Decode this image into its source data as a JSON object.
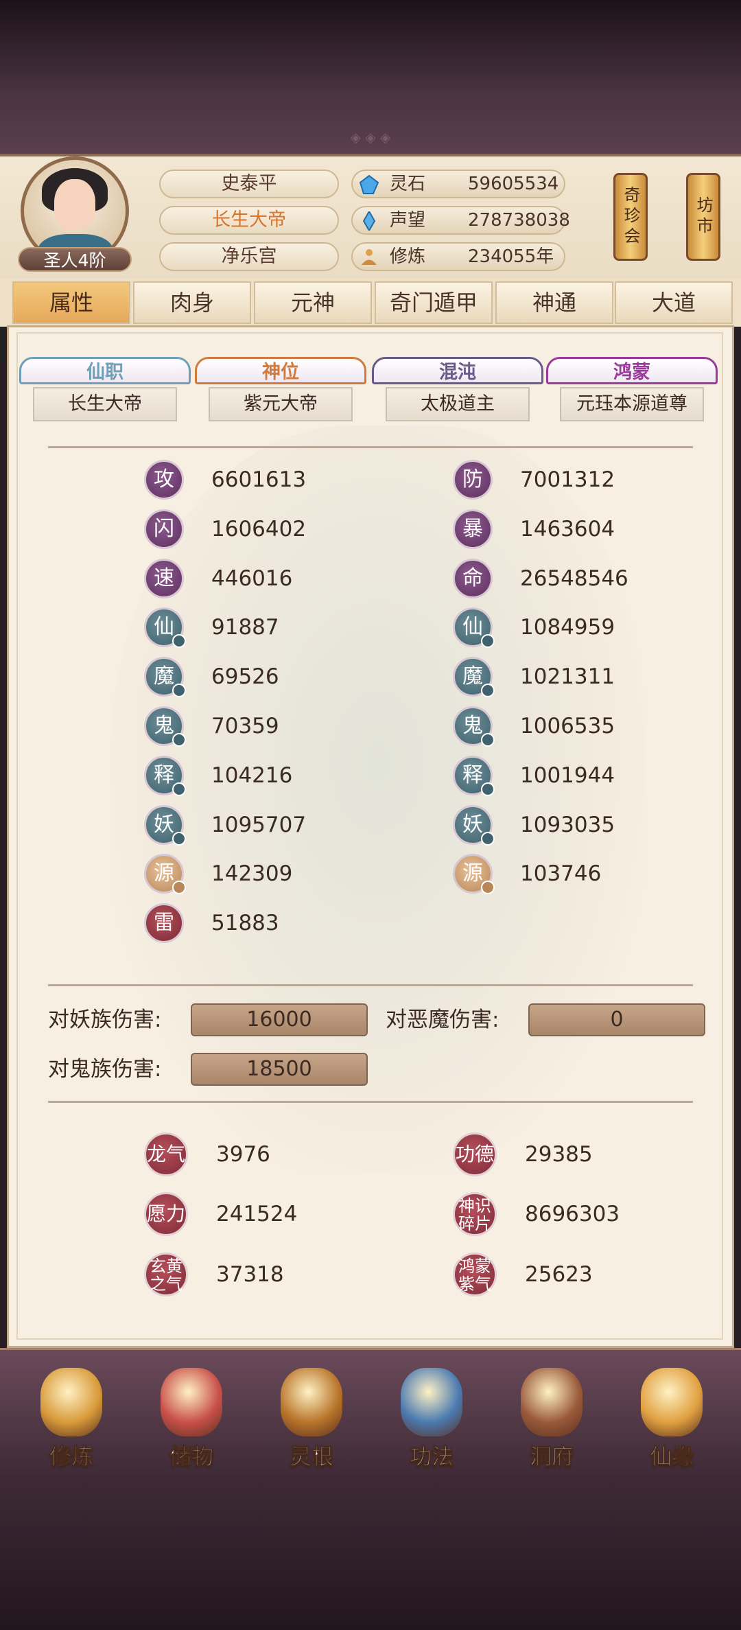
{
  "player": {
    "name": "史泰平",
    "title": "长生大帝",
    "palace": "净乐宫",
    "rank": "圣人4阶"
  },
  "resources": [
    {
      "label": "灵石",
      "value": "59605534",
      "icon": "spirit-stone-icon"
    },
    {
      "label": "声望",
      "value": "278738038",
      "icon": "prestige-crystal-icon"
    },
    {
      "label": "修炼",
      "value": "234055年",
      "icon": "meditation-icon"
    }
  ],
  "shops": {
    "treasure_fair": "奇珍会",
    "market": "坊市"
  },
  "tabs": [
    "属性",
    "肉身",
    "元神",
    "奇门遁甲",
    "神通",
    "大道"
  ],
  "active_tab": "属性",
  "titles": [
    {
      "label": "仙职",
      "value": "长生大帝",
      "color": "#6f9fb8"
    },
    {
      "label": "神位",
      "value": "紫元大帝",
      "color": "#d07a3e"
    },
    {
      "label": "混沌",
      "value": "太极道主",
      "color": "#6a5a8a"
    },
    {
      "label": "鸿蒙",
      "value": "元珏本源道尊",
      "color": "#9b3a9b"
    }
  ],
  "stats_left": [
    {
      "char": "攻",
      "value": "6601613",
      "style": "purple"
    },
    {
      "char": "闪",
      "value": "1606402",
      "style": "purple"
    },
    {
      "char": "速",
      "value": "446016",
      "style": "purple"
    },
    {
      "char": "仙",
      "value": "91887",
      "style": "teal"
    },
    {
      "char": "魔",
      "value": "69526",
      "style": "teal"
    },
    {
      "char": "鬼",
      "value": "70359",
      "style": "teal"
    },
    {
      "char": "释",
      "value": "104216",
      "style": "teal"
    },
    {
      "char": "妖",
      "value": "1095707",
      "style": "teal"
    },
    {
      "char": "源",
      "value": "142309",
      "style": "tan"
    },
    {
      "char": "雷",
      "value": "51883",
      "style": "red"
    }
  ],
  "stats_right": [
    {
      "char": "防",
      "value": "7001312",
      "style": "purple"
    },
    {
      "char": "暴",
      "value": "1463604",
      "style": "purple"
    },
    {
      "char": "命",
      "value": "26548546",
      "style": "purple"
    },
    {
      "char": "仙",
      "value": "1084959",
      "style": "teal"
    },
    {
      "char": "魔",
      "value": "1021311",
      "style": "teal"
    },
    {
      "char": "鬼",
      "value": "1006535",
      "style": "teal"
    },
    {
      "char": "释",
      "value": "1001944",
      "style": "teal"
    },
    {
      "char": "妖",
      "value": "1093035",
      "style": "teal"
    },
    {
      "char": "源",
      "value": "103746",
      "style": "tan"
    }
  ],
  "damage": [
    {
      "label": "对妖族伤害:",
      "value": "16000"
    },
    {
      "label": "对恶魔伤害:",
      "value": "0"
    },
    {
      "label": "对鬼族伤害:",
      "value": "18500"
    }
  ],
  "extras": [
    {
      "label": "龙气",
      "value": "3976"
    },
    {
      "label": "功德",
      "value": "29385"
    },
    {
      "label": "愿力",
      "value": "241524"
    },
    {
      "label": "神识碎片",
      "value": "8696303"
    },
    {
      "label": "玄黄之气",
      "value": "37318"
    },
    {
      "label": "鸿蒙紫气",
      "value": "25623"
    }
  ],
  "nav": [
    {
      "label": "修炼",
      "icon": "cultivation-icon",
      "color": "#d89a3a"
    },
    {
      "label": "储物",
      "icon": "storage-bag-icon",
      "color": "#c8504a"
    },
    {
      "label": "灵根",
      "icon": "spirit-root-icon",
      "color": "#b8742a"
    },
    {
      "label": "功法",
      "icon": "technique-book-icon",
      "color": "#4a7ab0"
    },
    {
      "label": "洞府",
      "icon": "cave-abode-icon",
      "color": "#9a5a3a"
    },
    {
      "label": "仙缘",
      "icon": "immortal-fate-icon",
      "color": "#e0a040"
    }
  ]
}
